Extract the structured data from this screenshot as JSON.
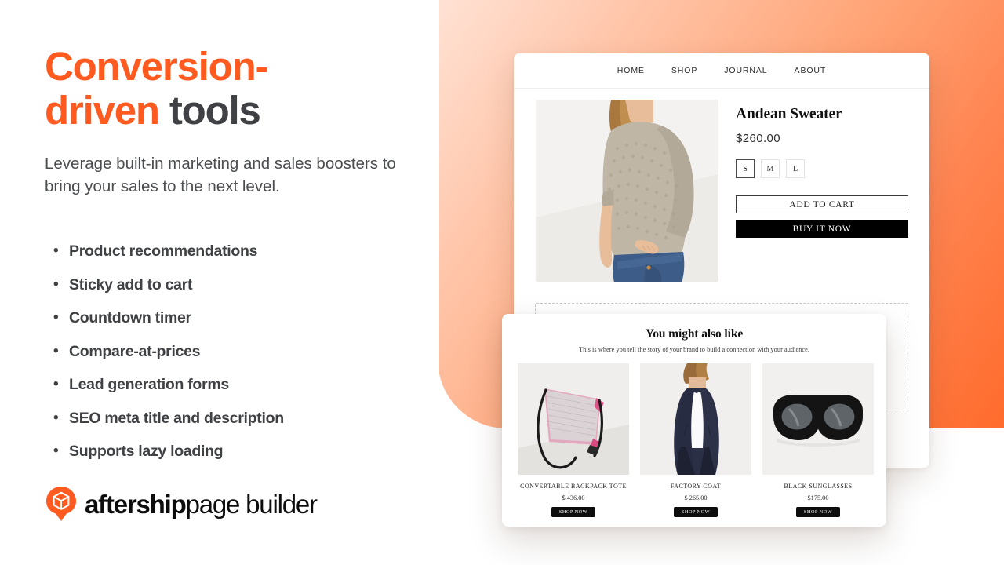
{
  "brand": {
    "accent_orange": "#FF5A1F",
    "dark_text": "#3F4145",
    "logo_bold": "aftership",
    "logo_light": "page builder",
    "logo_mark_icon": "aftership-pin-cube-icon"
  },
  "hero": {
    "headline_line1": "Conversion-",
    "headline_line2_accent": "driven ",
    "headline_line2_dark": "tools",
    "subhead": "Leverage built-in marketing and sales boosters to bring your sales to the next level.",
    "bullet_glyph": "•"
  },
  "features": [
    {
      "label": "Product recommendations"
    },
    {
      "label": "Sticky add to cart"
    },
    {
      "label": "Countdown timer"
    },
    {
      "label": "Compare-at-prices"
    },
    {
      "label": "Lead generation forms"
    },
    {
      "label": "SEO meta title and description"
    },
    {
      "label": "Supports lazy loading"
    }
  ],
  "storefront": {
    "nav": [
      {
        "label": "HOME"
      },
      {
        "label": "SHOP"
      },
      {
        "label": "JOURNAL"
      },
      {
        "label": "ABOUT"
      }
    ],
    "product": {
      "image_alt": "woman wearing beige knit sweater and blue jeans",
      "title": "Andean Sweater",
      "price": "$260.00",
      "sizes": [
        {
          "label": "S",
          "selected": true
        },
        {
          "label": "M",
          "selected": false
        },
        {
          "label": "L",
          "selected": false
        }
      ],
      "add_to_cart_label": "ADD TO CART",
      "buy_now_label": "BUY IT NOW"
    }
  },
  "recommendations": {
    "title": "You might also like",
    "subtitle": "This is where you tell the story of your brand to build a connection with your audience.",
    "items": [
      {
        "name": "CONVERTABLE BACKPACK TOTE",
        "price": "$ 436.00",
        "cta": "SHOP NOW",
        "image_alt": "mesh convertible backpack tote bag with pink lining"
      },
      {
        "name": "FACTORY COAT",
        "price": "$ 265.00",
        "cta": "SHOP NOW",
        "image_alt": "model wearing long navy factory coat over white shirt"
      },
      {
        "name": "BLACK SUNGLASSES",
        "price": "$175.00",
        "cta": "SHOP NOW",
        "image_alt": "round black framed sunglasses"
      }
    ]
  }
}
